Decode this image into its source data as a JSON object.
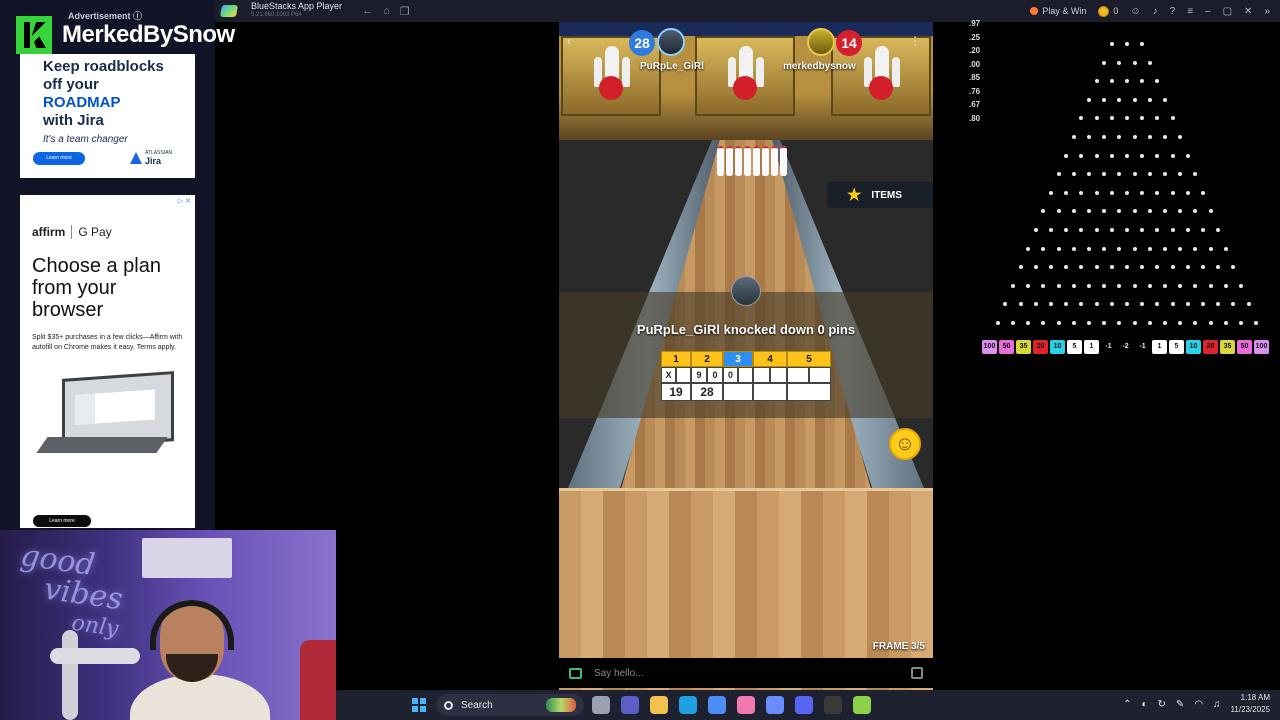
{
  "window": {
    "title": "BlueStacks App Player",
    "subtitle": "5.21.660.1003  P64",
    "play_win": "Play & Win",
    "coins": "0"
  },
  "overlay": {
    "brand": "MerkedBySnow",
    "ad_label": "Advertisement ⓘ"
  },
  "ad_jira": {
    "lines": [
      "Keep roadblocks",
      "off your",
      "ROADMAP",
      "with Jira"
    ],
    "tagline": "It's a team changer",
    "cta": "Learn more",
    "logo_top": "ATLASSIAN",
    "logo_bottom": "Jira"
  },
  "ad_affirm": {
    "badge": "▷ ✕",
    "brand1": "affirm",
    "brand2": "G Pay",
    "headline": "Choose a plan from your browser",
    "body": "Split $35+ purchases in a few clicks—Affirm with autofill on Chrome makes it easy. Terms apply.",
    "cta": "Learn more"
  },
  "webcam": {
    "neon_lines": [
      "good",
      "vibes",
      "only"
    ]
  },
  "game": {
    "player1": {
      "name": "PuRpLe_GiRl",
      "score": "28"
    },
    "player2": {
      "name": "merkedbysnow",
      "score": "14"
    },
    "items_label": "ITEMS",
    "message": "PuRpLe_GiRl knocked down 0 pins",
    "frame_label": "FRAME 3/5",
    "chat_placeholder": "Say hello...",
    "scorecard": {
      "frames": [
        "1",
        "2",
        "3",
        "4",
        "5"
      ],
      "current_frame": "3",
      "rolls": [
        [
          "X",
          ""
        ],
        [
          "9",
          "0"
        ],
        [
          "0",
          ""
        ],
        [
          "",
          ""
        ],
        [
          "",
          ""
        ]
      ],
      "totals": [
        "19",
        "28",
        "",
        "",
        ""
      ]
    }
  },
  "stats": {
    "odds": [
      ".97",
      ".25",
      ".20",
      ".00",
      ".85",
      ".76",
      ".67",
      ".80"
    ]
  },
  "plinko": {
    "buckets": [
      {
        "label": "100",
        "color": "#d98ef0"
      },
      {
        "label": "50",
        "color": "#e96ad8"
      },
      {
        "label": "35",
        "color": "#d8d83a"
      },
      {
        "label": "20",
        "color": "#e0232b"
      },
      {
        "label": "10",
        "color": "#28d0e8"
      },
      {
        "label": "5",
        "color": "#ffffff"
      },
      {
        "label": "1",
        "color": "#ffffff"
      },
      {
        "label": "-1",
        "color": "#000000"
      },
      {
        "label": "-2",
        "color": "#000000"
      },
      {
        "label": "-1",
        "color": "#000000"
      },
      {
        "label": "1",
        "color": "#ffffff"
      },
      {
        "label": "5",
        "color": "#ffffff"
      },
      {
        "label": "10",
        "color": "#28d0e8"
      },
      {
        "label": "20",
        "color": "#e0232b"
      },
      {
        "label": "35",
        "color": "#d8d83a"
      },
      {
        "label": "50",
        "color": "#e96ad8"
      },
      {
        "label": "100",
        "color": "#d98ef0"
      }
    ]
  },
  "taskbar": {
    "search_label": "Search",
    "time": "1:18 AM",
    "date": "11/23/2025",
    "apps": [
      {
        "name": "task-view",
        "color": "#9aa0b0"
      },
      {
        "name": "teams",
        "color": "#5b5fc7"
      },
      {
        "name": "file-explorer",
        "color": "#f2c14e"
      },
      {
        "name": "edge",
        "color": "#1fa0e0"
      },
      {
        "name": "store",
        "color": "#4c8df6"
      },
      {
        "name": "photos",
        "color": "#f07ab0"
      },
      {
        "name": "copilot",
        "color": "#6b8cff"
      },
      {
        "name": "discord",
        "color": "#5865f2"
      },
      {
        "name": "obs",
        "color": "#3a3a3a"
      },
      {
        "name": "bluestacks",
        "color": "#8bd24a"
      }
    ]
  }
}
